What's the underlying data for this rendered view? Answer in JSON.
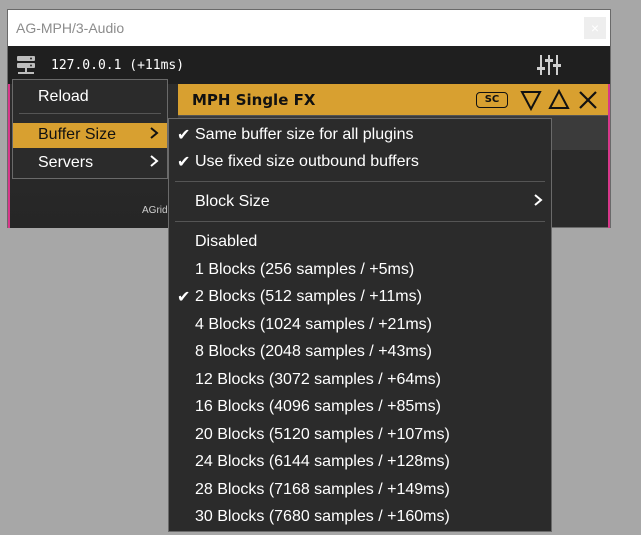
{
  "window": {
    "title": "AG-MPH/3-Audio",
    "close_label": "×"
  },
  "topbar": {
    "server_text": "127.0.0.1 (+11ms)"
  },
  "plugin": {
    "name": "MPH Single FX",
    "sc_label": "SC"
  },
  "footer": {
    "agrid": "AGrid"
  },
  "context_menu": {
    "reload": "Reload",
    "buffer_size": "Buffer Size",
    "servers": "Servers"
  },
  "buffer_menu": {
    "same_buffer": "Same buffer size for all plugins",
    "fixed_outbound": "Use fixed size outbound buffers",
    "block_size": "Block Size",
    "options": [
      {
        "label": "Disabled",
        "checked": false
      },
      {
        "label": "1 Blocks (256 samples / +5ms)",
        "checked": false
      },
      {
        "label": "2 Blocks (512 samples / +11ms)",
        "checked": true
      },
      {
        "label": "4 Blocks (1024 samples / +21ms)",
        "checked": false
      },
      {
        "label": "8 Blocks (2048 samples / +43ms)",
        "checked": false
      },
      {
        "label": "12 Blocks (3072 samples / +64ms)",
        "checked": false
      },
      {
        "label": "16 Blocks (4096 samples / +85ms)",
        "checked": false
      },
      {
        "label": "20 Blocks (5120 samples / +107ms)",
        "checked": false
      },
      {
        "label": "24 Blocks (6144 samples / +128ms)",
        "checked": false
      },
      {
        "label": "28 Blocks (7168 samples / +149ms)",
        "checked": false
      },
      {
        "label": "30 Blocks (7680 samples / +160ms)",
        "checked": false
      }
    ]
  },
  "colors": {
    "accent": "#d8a030",
    "menu_bg": "#2b2b2b",
    "edge": "#d8378a"
  }
}
